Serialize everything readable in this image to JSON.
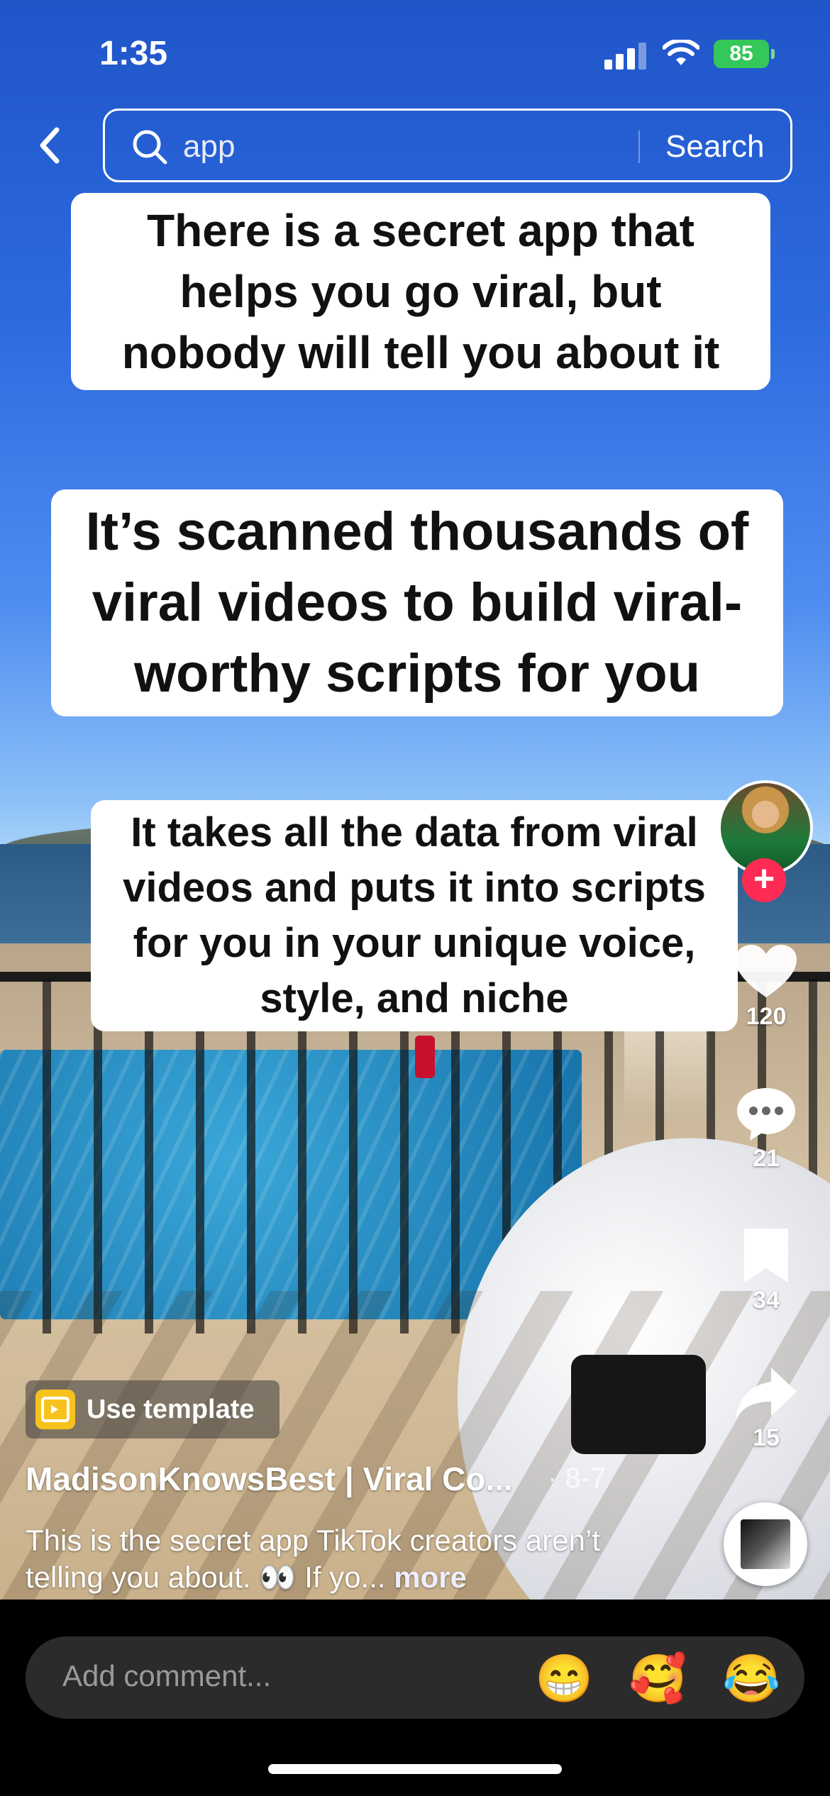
{
  "status_bar": {
    "time": "1:35",
    "battery": "85"
  },
  "search": {
    "query": "app",
    "button_label": "Search"
  },
  "captions": {
    "first": "There is a secret app that helps you go viral, but nobody will tell you about it",
    "second": "It’s scanned thousands of viral videos to build viral-worthy scripts for you",
    "third": "It takes all the data from viral videos and puts it into scripts for you in your unique voice, style, and niche"
  },
  "actions": {
    "likes": "120",
    "comments": "21",
    "saves": "34",
    "shares": "15"
  },
  "follow_label": "+",
  "template": {
    "label": "Use template"
  },
  "post": {
    "creator": "MadisonKnowsBest | Viral Co...",
    "date": "· 8-7",
    "description": "This is the secret app TikTok creators aren’t telling you about. 👀 If yo...",
    "more_label": "more"
  },
  "comment_bar": {
    "placeholder": "Add comment...",
    "emojis": [
      "😁",
      "🥰",
      "😂"
    ]
  },
  "colors": {
    "accent": "#fe2c55",
    "battery": "#34c759",
    "template_icon": "#f7c21e"
  },
  "icons": [
    "back-icon",
    "search-icon",
    "heart-icon",
    "comment-icon",
    "bookmark-icon",
    "share-icon",
    "template-icon"
  ]
}
